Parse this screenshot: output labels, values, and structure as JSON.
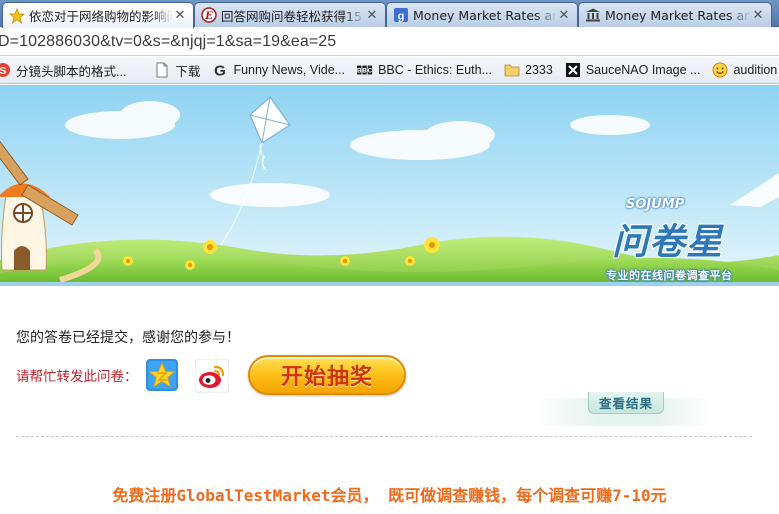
{
  "browser": {
    "tabs": [
      {
        "title": "依恋对于网络购物的影响问卷",
        "icon": "star-icon",
        "active": true
      },
      {
        "title": "回答网购问卷轻松获得15",
        "icon": "e-logo-icon",
        "active": false
      },
      {
        "title": "Money Market Rates an",
        "icon": "google-icon",
        "active": false
      },
      {
        "title": "Money Market Rates an",
        "icon": "bank-icon",
        "active": false
      }
    ],
    "address": "D=102886030&tv=0&s=&njqj=1&sa=19&ea=25",
    "bookmarks": [
      {
        "label": "分镜头脚本的格式...",
        "icon": "s-logo-icon"
      },
      {
        "label": "下载",
        "icon": "page-icon"
      },
      {
        "label": "Funny News, Vide...",
        "icon": "google-g-icon"
      },
      {
        "label": "BBC - Ethics: Euth...",
        "icon": "bbc-icon"
      },
      {
        "label": "2333",
        "icon": "folder-icon"
      },
      {
        "label": "SauceNAO Image ...",
        "icon": "saucenao-icon"
      },
      {
        "label": "audition",
        "icon": "smiley-icon"
      }
    ]
  },
  "banner": {
    "brand_en": "SOJUMP",
    "brand_cn": "问卷星",
    "slogan": "专业的在线问卷调查平台"
  },
  "content": {
    "thanks": "您的答卷已经提交，感谢您的参与！",
    "share_label": "请帮忙转发此问卷：",
    "lottery_button": "开始抽奖",
    "results_button": "查看结果",
    "promo": "免费注册GlobalTestMarket会员， 既可做调查赚钱，每个调查可赚7-10元"
  },
  "colors": {
    "share_label": "#c0202a",
    "promo": "#ef6a1a",
    "lottery_text": "#d0320a",
    "sky": "#bfe6f7",
    "grass": "#8fd14a"
  }
}
